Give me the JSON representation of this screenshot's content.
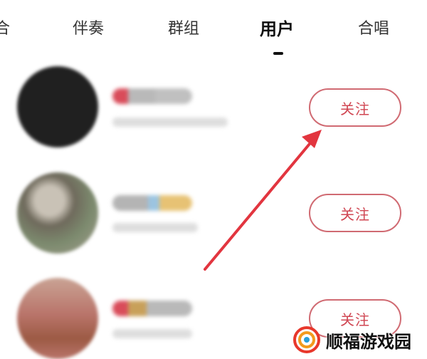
{
  "tabs": [
    {
      "label": "合",
      "active": false
    },
    {
      "label": "伴奏",
      "active": false
    },
    {
      "label": "群组",
      "active": false
    },
    {
      "label": "用户",
      "active": true
    },
    {
      "label": "合唱",
      "active": false
    }
  ],
  "users": [
    {
      "follow_label": "关注",
      "avatar_color": "#202020"
    },
    {
      "follow_label": "关注",
      "avatar_color": "#7c8a6e"
    },
    {
      "follow_label": "关注",
      "avatar_color": "#b9746a"
    }
  ],
  "watermark": {
    "text": "顺福游戏园"
  },
  "colors": {
    "accent": "#d04652",
    "button_border": "#d06a72",
    "arrow": "#e2353f",
    "watermark_ring_outer": "#e8372b",
    "watermark_ring_inner": "#f39a1e"
  }
}
